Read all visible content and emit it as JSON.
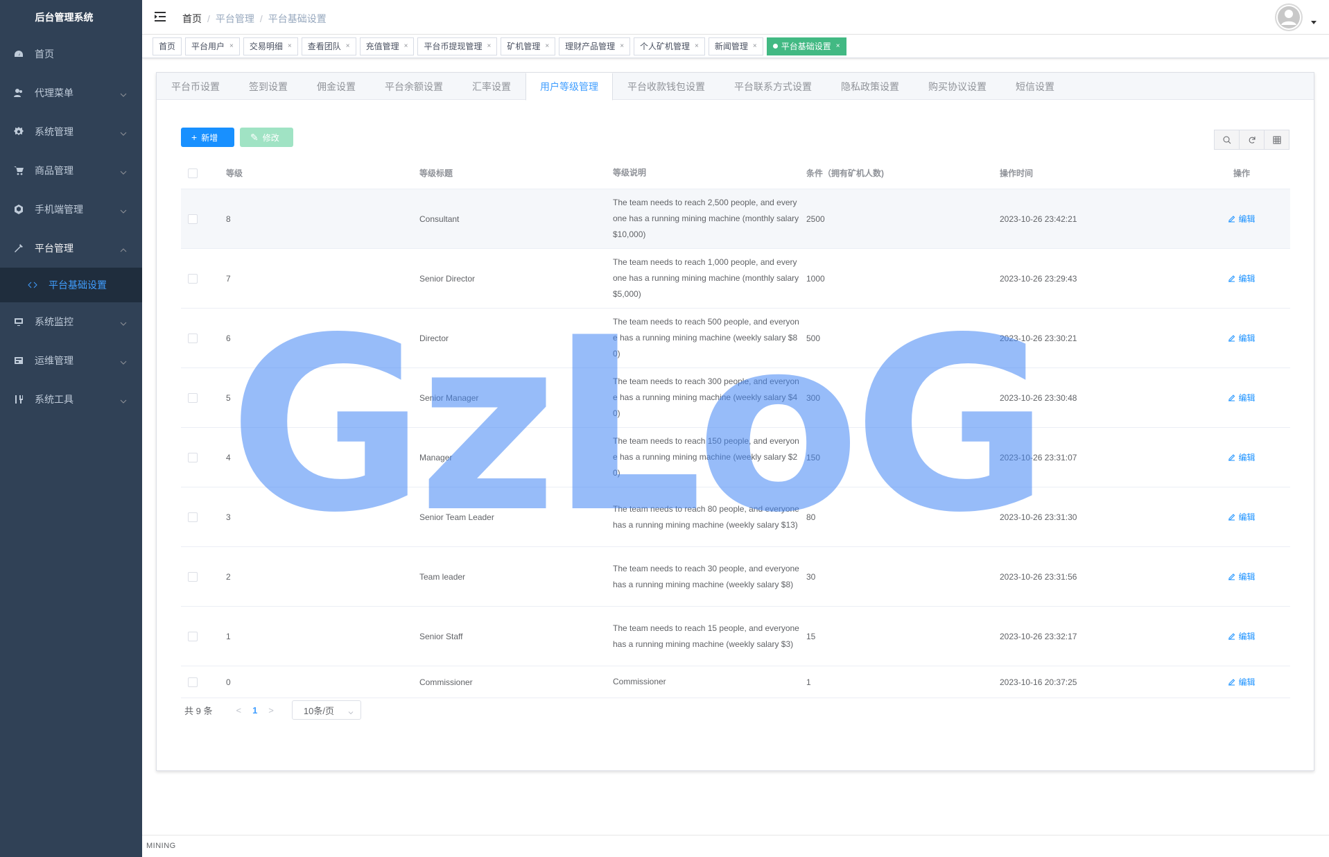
{
  "app": {
    "title": "后台管理系统"
  },
  "sidebar": {
    "items": [
      {
        "label": "首页",
        "icon": "dashboard-icon"
      },
      {
        "label": "代理菜单",
        "icon": "peoples-icon"
      },
      {
        "label": "系统管理",
        "icon": "system-gear-icon"
      },
      {
        "label": "商品管理",
        "icon": "shopping-cart-icon"
      },
      {
        "label": "手机端管理",
        "icon": "cube-icon"
      },
      {
        "label": "平台管理",
        "icon": "tool-icon"
      },
      {
        "label": "系统监控",
        "icon": "monitor-icon"
      },
      {
        "label": "运维管理",
        "icon": "server-icon"
      },
      {
        "label": "系统工具",
        "icon": "tools-icon"
      }
    ],
    "submenu_active": "平台基础设置"
  },
  "breadcrumb": [
    "首页",
    "平台管理",
    "平台基础设置"
  ],
  "tags": [
    {
      "label": "首页"
    },
    {
      "label": "平台用户"
    },
    {
      "label": "交易明细"
    },
    {
      "label": "查看团队"
    },
    {
      "label": "充值管理"
    },
    {
      "label": "平台币提现管理"
    },
    {
      "label": "矿机管理"
    },
    {
      "label": "理财产品管理"
    },
    {
      "label": "个人矿机管理"
    },
    {
      "label": "新闻管理"
    },
    {
      "label": "平台基础设置",
      "active": true
    }
  ],
  "tabs": [
    "平台币设置",
    "签到设置",
    "佣金设置",
    "平台余额设置",
    "汇率设置",
    "用户等级管理",
    "平台收款钱包设置",
    "平台联系方式设置",
    "隐私政策设置",
    "购买协议设置",
    "短信设置"
  ],
  "active_tab": "用户等级管理",
  "toolbar": {
    "add": "新增",
    "edit": "修改"
  },
  "table": {
    "headers": {
      "level": "等级",
      "title": "等级标题",
      "desc": "等级说明",
      "cond": "条件（拥有矿机人数)",
      "time": "操作时间",
      "op": "操作"
    },
    "edit_label": "编辑",
    "rows": [
      {
        "level": "8",
        "title": "Consultant",
        "desc": "The team needs to reach 2,500 people, and everyone has a running mining machine (monthly salary $10,000)",
        "cond": "2500",
        "time": "2023-10-26 23:42:21"
      },
      {
        "level": "7",
        "title": "Senior Director",
        "desc": "The team needs to reach 1,000 people, and everyone has a running mining machine (monthly salary $5,000)",
        "cond": "1000",
        "time": "2023-10-26 23:29:43"
      },
      {
        "level": "6",
        "title": "Director",
        "desc": "The team needs to reach 500 people, and everyone has a running mining machine (weekly salary $80)",
        "cond": "500",
        "time": "2023-10-26 23:30:21"
      },
      {
        "level": "5",
        "title": "Senior Manager",
        "desc": "The team needs to reach 300 people, and everyone has a running mining machine (weekly salary $40)",
        "cond": "300",
        "time": "2023-10-26 23:30:48"
      },
      {
        "level": "4",
        "title": "Manager",
        "desc": "The team needs to reach 150 people, and everyone has a running mining machine (weekly salary $20)",
        "cond": "150",
        "time": "2023-10-26 23:31:07"
      },
      {
        "level": "3",
        "title": "Senior Team Leader",
        "desc": "The team needs to reach 80 people, and everyone has a running mining machine (weekly salary $13)",
        "cond": "80",
        "time": "2023-10-26 23:31:30"
      },
      {
        "level": "2",
        "title": "Team leader",
        "desc": "The team needs to reach 30 people, and everyone has a running mining machine (weekly salary $8)",
        "cond": "30",
        "time": "2023-10-26 23:31:56"
      },
      {
        "level": "1",
        "title": "Senior Staff",
        "desc": "The team needs to reach 15 people, and everyone has a running mining machine (weekly salary $3)",
        "cond": "15",
        "time": "2023-10-26 23:32:17"
      },
      {
        "level": "0",
        "title": "Commissioner",
        "desc": "Commissioner",
        "cond": "1",
        "time": "2023-10-16 20:37:25"
      }
    ]
  },
  "pagination": {
    "total": "共 9 条",
    "page": "1",
    "page_size": "10条/页"
  },
  "footer": "MINING",
  "watermark": "GzLoG"
}
